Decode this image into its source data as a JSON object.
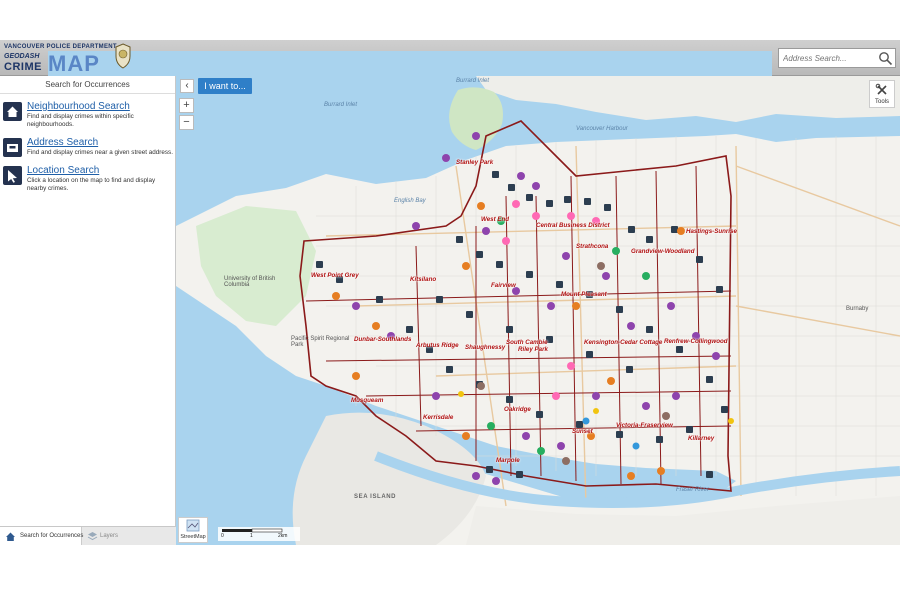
{
  "header": {
    "dept": "VANCOUVER POLICE DEPARTMENT",
    "logo_geodash": "GEODASH",
    "logo_crime": "CRIME",
    "logo_map": "MAP",
    "search_placeholder": "Address Search..."
  },
  "panel": {
    "title": "Search for Occurrences",
    "items": [
      {
        "label": "Neighbourhood Search",
        "desc": "Find and display crimes within specific neighbourhoods.",
        "icon": "house-icon"
      },
      {
        "label": "Address Search",
        "desc": "Find and display crimes near a given street address.",
        "icon": "mailbox-icon"
      },
      {
        "label": "Location Search",
        "desc": "Click a location on the map to find and display nearby crimes.",
        "icon": "cursor-icon"
      }
    ],
    "tabs": [
      {
        "label": "Search for Occurrences",
        "icon": "home-icon",
        "active": true
      },
      {
        "label": "Layers",
        "icon": "layers-icon",
        "active": false
      }
    ]
  },
  "map": {
    "collapse": "‹",
    "i_want_to": "I want to...",
    "zoom_in": "+",
    "zoom_out": "−",
    "tools_label": "Tools",
    "streetmap_label": "StreetMap",
    "scale": [
      "0",
      "1",
      "2km"
    ],
    "accent_color": "#2f7fc8",
    "boundary_color": "#8b1a1a",
    "neighbourhoods": [
      "Stanley Park",
      "West End",
      "Central Business District",
      "Strathcona",
      "Grandview-Woodland",
      "Hastings-Sunrise",
      "West Point Grey",
      "Kitsilano",
      "Fairview",
      "Mount Pleasant",
      "Dunbar-Southlands",
      "Arbutus Ridge",
      "Shaughnessy",
      "South Cambie",
      "Riley Park",
      "Kensington-Cedar Cottage",
      "Renfrew-Collingwood",
      "Musqueam",
      "Kerrisdale",
      "Oakridge",
      "Sunset",
      "Victoria-Fraserview",
      "Killarney",
      "Marpole"
    ],
    "place_labels": [
      "Burrard Inlet",
      "Vancouver Harbour",
      "English Bay",
      "University of British Columbia",
      "Pacific Spirit Regional Park",
      "SEA ISLAND",
      "Burnaby",
      "Fraser River"
    ]
  }
}
